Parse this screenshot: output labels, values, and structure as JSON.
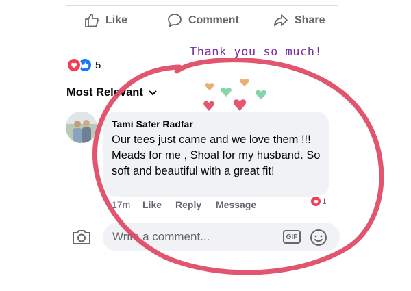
{
  "actions": {
    "like_label": "Like",
    "comment_label": "Comment",
    "share_label": "Share"
  },
  "reactions": {
    "count": "5",
    "icons": [
      "love-icon",
      "like-icon"
    ]
  },
  "annotation": {
    "text": "Thank you so much!",
    "ink_color": "#e0405a",
    "text_color": "#7b2fa0"
  },
  "sort": {
    "label": "Most Relevant"
  },
  "comment": {
    "author": "Tami Safer Radfar",
    "text": "Our tees just came and we love them !!! Meads for me , Shoal for my husband. So soft and beautiful with a great fit!",
    "time": "17m",
    "like_label": "Like",
    "reply_label": "Reply",
    "message_label": "Message",
    "reaction_count": "1"
  },
  "composer": {
    "placeholder": "Write a comment...",
    "gif_label": "GIF"
  },
  "colors": {
    "accent_blue": "#1877f2",
    "love_red": "#f33e58",
    "muted": "#65676b",
    "bubble_bg": "#f0f2f5"
  }
}
